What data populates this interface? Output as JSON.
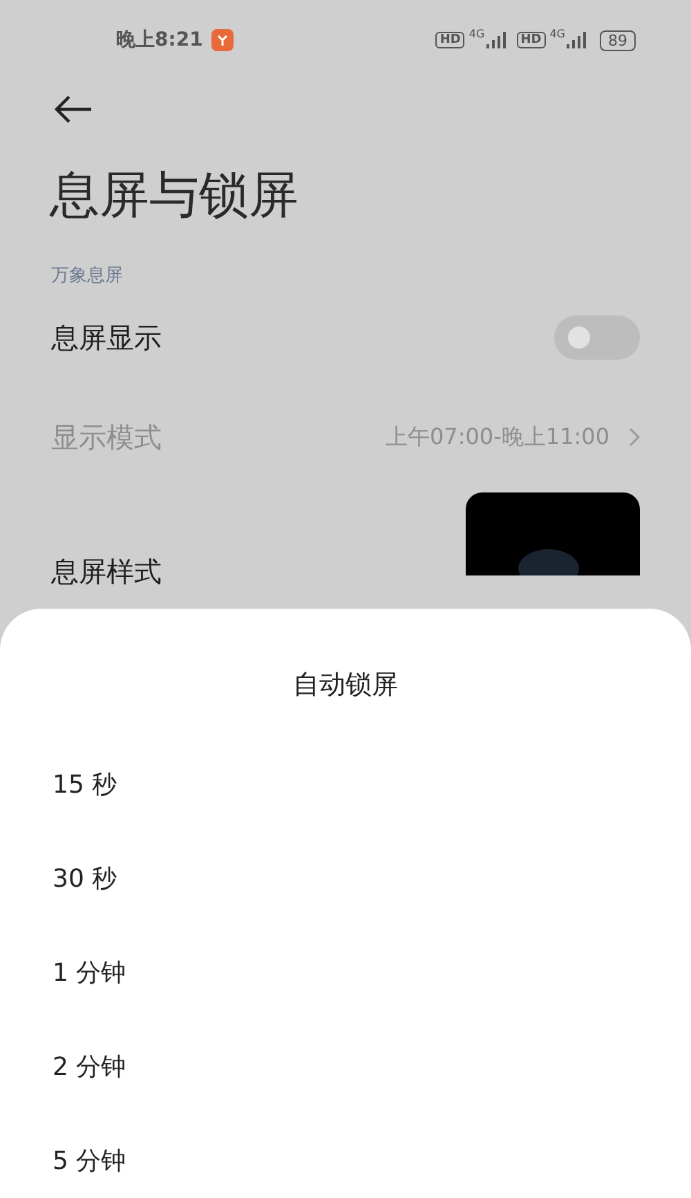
{
  "status_bar": {
    "time": "晚上8:21",
    "hd_labels": [
      "HD",
      "HD"
    ],
    "network_labels": [
      "4G",
      "4G"
    ],
    "battery": "89"
  },
  "page": {
    "title": "息屏与锁屏",
    "section": "万象息屏",
    "rows": [
      {
        "kind": "toggle",
        "label": "息屏显示",
        "on": false
      },
      {
        "kind": "link",
        "label": "显示模式",
        "value": "上午07:00-晚上11:00",
        "disabled": true
      },
      {
        "kind": "preview",
        "label": "息屏样式"
      }
    ]
  },
  "sheet": {
    "title": "自动锁屏",
    "options": [
      "15 秒",
      "30 秒",
      "1 分钟",
      "2 分钟",
      "5 分钟"
    ]
  }
}
